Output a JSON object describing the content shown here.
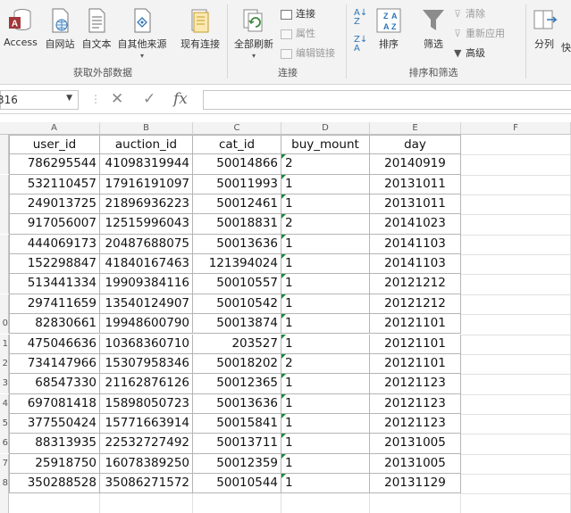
{
  "ribbon": {
    "get_external": {
      "label": "获取外部数据",
      "buttons": [
        {
          "label": "Access",
          "icon": "access-icon"
        },
        {
          "label": "自网站",
          "icon": "web-icon"
        },
        {
          "label": "自文本",
          "icon": "text-file-icon"
        },
        {
          "label": "自其他来源",
          "icon": "other-sources-icon"
        },
        {
          "label": "现有连接",
          "icon": "existing-connections-icon"
        }
      ]
    },
    "connections": {
      "label": "连接",
      "refresh_all": "全部刷新",
      "small": [
        "连接",
        "属性",
        "编辑链接"
      ]
    },
    "sort_filter": {
      "label": "排序和筛选",
      "sort": "排序",
      "filter": "筛选",
      "small": [
        "清除",
        "重新应用",
        "高级"
      ]
    },
    "data_tools": {
      "split": "分列",
      "quick": "快"
    }
  },
  "formula_bar": {
    "name_box": "316",
    "cancel_glyph": "✕",
    "enter_glyph": "✓",
    "fx_glyph": "fx",
    "content": ""
  },
  "sheet": {
    "columns": [
      "A",
      "B",
      "C",
      "D",
      "E",
      "F"
    ],
    "row_numbers": [
      "",
      "",
      "",
      "",
      "",
      "",
      "",
      "",
      "",
      "0",
      "1",
      "2",
      "3",
      "4",
      "5",
      "6",
      "7",
      "8"
    ],
    "header": [
      "user_id",
      "auction_id",
      "cat_id",
      "buy_mount",
      "day"
    ],
    "rows": [
      [
        "786295544",
        "41098319944",
        "50014866",
        "2",
        "20140919"
      ],
      [
        "532110457",
        "17916191097",
        "50011993",
        "1",
        "20131011"
      ],
      [
        "249013725",
        "21896936223",
        "50012461",
        "1",
        "20131011"
      ],
      [
        "917056007",
        "12515996043",
        "50018831",
        "2",
        "20141023"
      ],
      [
        "444069173",
        "20487688075",
        "50013636",
        "1",
        "20141103"
      ],
      [
        "152298847",
        "41840167463",
        "121394024",
        "1",
        "20141103"
      ],
      [
        "513441334",
        "19909384116",
        "50010557",
        "1",
        "20121212"
      ],
      [
        "297411659",
        "13540124907",
        "50010542",
        "1",
        "20121212"
      ],
      [
        "82830661",
        "19948600790",
        "50013874",
        "1",
        "20121101"
      ],
      [
        "475046636",
        "10368360710",
        "203527",
        "1",
        "20121101"
      ],
      [
        "734147966",
        "15307958346",
        "50018202",
        "2",
        "20121101"
      ],
      [
        "68547330",
        "21162876126",
        "50012365",
        "1",
        "20121123"
      ],
      [
        "697081418",
        "15898050723",
        "50013636",
        "1",
        "20121123"
      ],
      [
        "377550424",
        "15771663914",
        "50015841",
        "1",
        "20121123"
      ],
      [
        "88313935",
        "22532727492",
        "50013711",
        "1",
        "20131005"
      ],
      [
        "25918750",
        "16078389250",
        "50012359",
        "1",
        "20131005"
      ],
      [
        "350288528",
        "35086271572",
        "50010544",
        "1",
        "20131129"
      ]
    ]
  }
}
